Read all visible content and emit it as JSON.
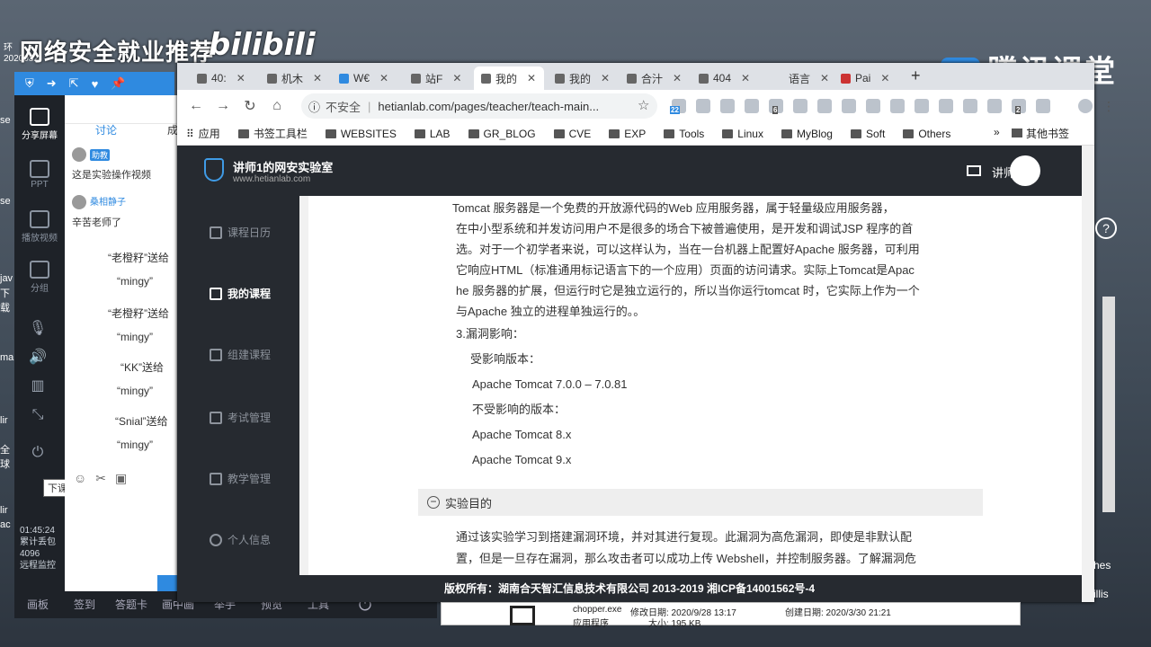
{
  "overlay": {
    "banner": "网络安全就业推荐",
    "bilibili": "bilibili",
    "small_id_1": "环",
    "small_id_2": "2020032",
    "tencent": "腾讯课堂"
  },
  "live_tool": {
    "rail": [
      {
        "label": "分享屏幕"
      },
      {
        "label": "PPT"
      },
      {
        "label": "播放视频"
      },
      {
        "label": "分组"
      }
    ],
    "tooltip": "下课",
    "clock": "01:45:24",
    "stats": [
      "累计丢包",
      "4096",
      "远程监控"
    ],
    "bottom": [
      "画板",
      "签到",
      "答题卡",
      "画中画",
      "举手",
      "预览",
      "工具"
    ]
  },
  "chat": {
    "tab": "讨论",
    "tab_b": "成",
    "messages": [
      {
        "badge": "助教",
        "name": "",
        "text": "这是实验操作视频"
      },
      {
        "badge": "",
        "name": "桑相静子",
        "text": "辛苦老师了"
      }
    ],
    "gifts": [
      {
        "from": "“老橙籽”送给",
        "to": "“mingy”"
      },
      {
        "from": "“老橙籽”送给",
        "to": "“mingy”"
      },
      {
        "from": "“KK”送给",
        "to": "“mingy”"
      },
      {
        "from": "“Snial”送给",
        "to": "“mingy”"
      }
    ]
  },
  "browser": {
    "tabs": [
      {
        "label": "40:"
      },
      {
        "label": "机木"
      },
      {
        "label": "W€"
      },
      {
        "label": "站F"
      },
      {
        "label": "我的"
      },
      {
        "label": "我的"
      },
      {
        "label": "合汁"
      },
      {
        "label": "404"
      },
      {
        "label": "语言"
      },
      {
        "label": "Pai"
      }
    ],
    "insecure": "不安全",
    "url": "hetianlab.com/pages/teacher/teach-main...",
    "ext_badges": [
      "22",
      "6",
      "2"
    ],
    "bookmarks": [
      "应用",
      "书签工具栏",
      "WEBSITES",
      "LAB",
      "GR_BLOG",
      "CVE",
      "EXP",
      "Tools",
      "Linux",
      "MyBlog",
      "Soft",
      "Others"
    ],
    "bookmarks_more": "»",
    "bookmarks_other": "其他书签"
  },
  "site": {
    "name": "讲师1的网安实验室",
    "domain": "www.hetianlab.com",
    "user": "讲师1",
    "nav": [
      "课程日历",
      "我的课程",
      "组建课程",
      "考试管理",
      "教学管理",
      "个人信息"
    ],
    "para1": [
      "Tomcat 服务器是一个免费的开放源代码的Web 应用服务器，属于轻量级应用服务器，",
      "在中小型系统和并发访问用户不是很多的场合下被普遍使用，是开发和调试JSP 程序的首",
      "选。对于一个初学者来说，可以这样认为，当在一台机器上配置好Apache 服务器，可利用",
      "它响应HTML（标准通用标记语言下的一个应用）页面的访问请求。实际上Tomcat是Apac",
      "he 服务器的扩展，但运行时它是独立运行的，所以当你运行tomcat 时，它实际上作为一个",
      "与Apache 独立的进程单独运行的。。"
    ],
    "impact_title": "3.漏洞影响：",
    "affected_label": "受影响版本：",
    "affected": "Apache Tomcat 7.0.0 – 7.0.81",
    "unaffected_label": "不受影响的版本：",
    "unaffected": [
      "Apache Tomcat 8.x",
      "Apache Tomcat 9.x"
    ],
    "goal_title": "实验目的",
    "goal_text": [
      "通过该实验学习到搭建漏洞环境，并对其进行复现。此漏洞为高危漏洞，即使是非默认配",
      "置，但是一旦存在漏洞，那么攻击者可以成功上传 Webshell，并控制服务器。了解漏洞危"
    ],
    "footer": "版权所有：湖南合天智汇信息技术有限公司 2013-2019 湘ICP备14001562号-4"
  },
  "explorer": {
    "file": "chopper.exe",
    "modified": "修改日期: 2020/9/28 13:17",
    "created": "创建日期: 2020/3/30 21:21",
    "type": "应用程序",
    "size": "大小: 195 KB"
  },
  "desktop_right": {
    "help": "?",
    "text_1": "hes",
    "text_2": "illis"
  },
  "desktop_left": [
    "se",
    "se",
    "jav",
    "下载",
    "ma",
    "lir",
    "全球",
    "lir",
    "ac"
  ]
}
